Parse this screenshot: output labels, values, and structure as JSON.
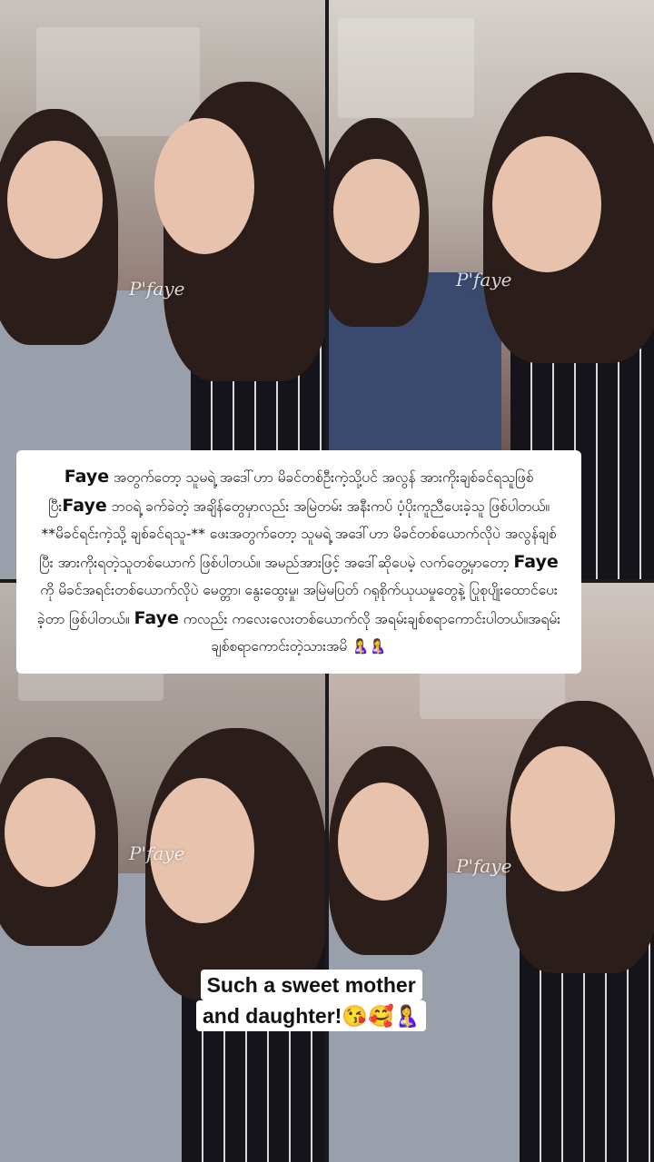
{
  "panels": [
    {
      "watermark": "P'faye"
    },
    {
      "watermark": "P'faye"
    },
    {
      "watermark": "P'faye"
    },
    {
      "watermark": "P'faye"
    }
  ],
  "caption": {
    "name1": "Faye",
    "part1": " အတွက်တော့ သူမရဲ့ အဒေါ်ဟာ မိခင်တစ်ဦးကဲ့သို့ပင် အလွန် အားကိုးချစ်ခင်ရသူဖြစ်ပြီး",
    "name2": "Faye",
    "part2": " ဘဝရဲ့ ခက်ခဲတဲ့ အချိန်တွေမှာလည်း အမြဲတမ်း အနီးကပ် ပံ့ပိုးကူညီပေးခဲ့သူ ဖြစ်ပါတယ်။**မိခင်ရင်းကဲ့သို့ ချစ်ခင်ရသူ-** ဖေးအတွက်တော့ သူမရဲ့ အဒေါ်ဟာ မိခင်တစ်ယောက်လိုပဲ အလွန်ချစ်ပြီး အားကိုးရတဲ့သူတစ်ယောက် ဖြစ်ပါတယ်။  အမည်အားဖြင့် အဒေါ်ဆိုပေမဲ့ လက်တွေ့မှာတော့ ",
    "name3": "Faye",
    "part3": " ကို မိခင်အရင်းတစ်ယောက်လိုပဲ မေတ္တာ၊ နွေးထွေးမှု၊ အမြဲမပြတ် ဂရုစိုက်ယုယမှုတွေနဲ့ ပြုစုပျိုးထောင်ပေးခဲ့တာ ဖြစ်ပါတယ်။ ",
    "name4": "Faye",
    "part4": " ကလည်း ကလေးလေးတစ်ယောက်လို အရမ်းချစ်စရာကောင်းပါတယ်။အရမ်းချစ်စရာကောင်းတဲ့သားအမိ 🤱🤱"
  },
  "subtitle": {
    "line1": "Such a sweet mother",
    "line2": "and daughter!😘🥰🤱"
  },
  "colors": {
    "caption_bg": "#ffffff",
    "text": "#111111",
    "divider": "#1b1b1d"
  }
}
